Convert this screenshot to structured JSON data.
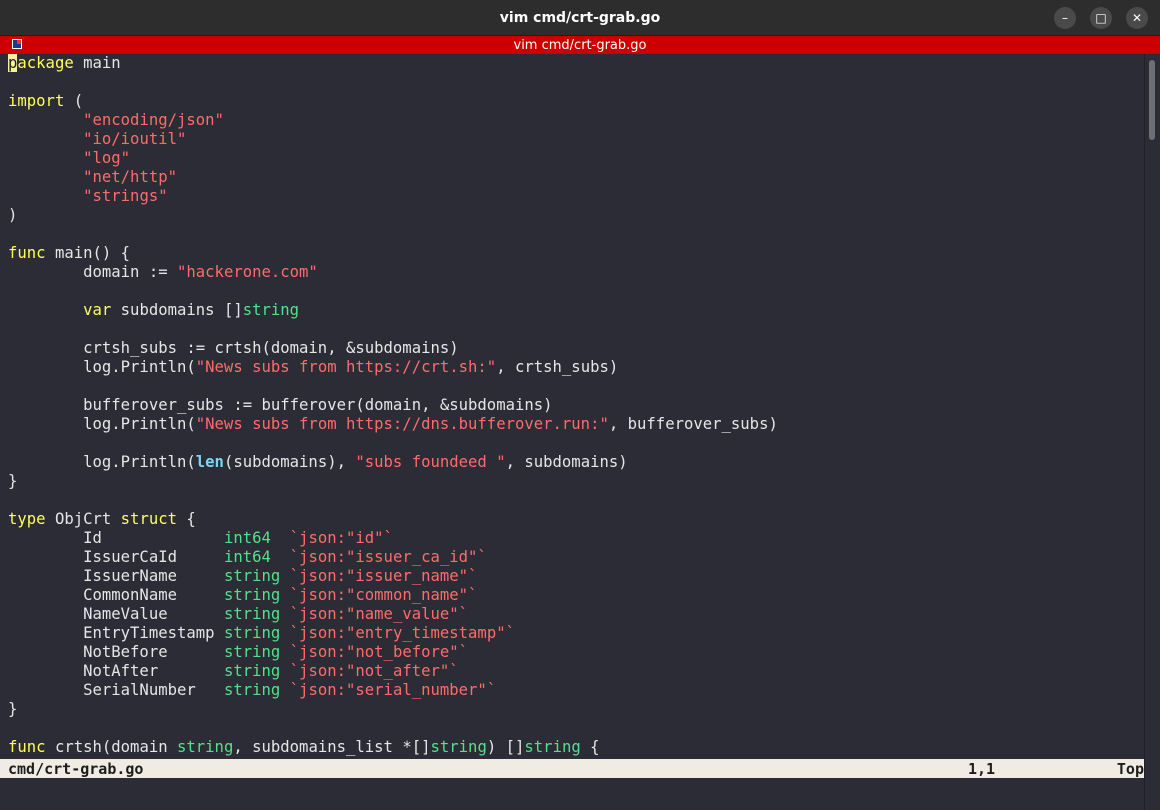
{
  "window": {
    "title": "vim cmd/crt-grab.go",
    "tab_title": "vim cmd/crt-grab.go",
    "minimize_icon": "minimize-icon",
    "maximize_icon": "maximize-icon",
    "close_icon": "close-icon"
  },
  "editor": {
    "lines": [
      [
        {
          "t": "p",
          "c": "cursor"
        },
        {
          "t": "ackage",
          "c": "kw"
        },
        {
          "t": " main",
          "c": ""
        }
      ],
      [],
      [
        {
          "t": "import",
          "c": "kw"
        },
        {
          "t": " (",
          "c": ""
        }
      ],
      [
        {
          "t": "        ",
          "c": ""
        },
        {
          "t": "\"encoding/json\"",
          "c": "str"
        }
      ],
      [
        {
          "t": "        ",
          "c": ""
        },
        {
          "t": "\"io/ioutil\"",
          "c": "str"
        }
      ],
      [
        {
          "t": "        ",
          "c": ""
        },
        {
          "t": "\"log\"",
          "c": "str"
        }
      ],
      [
        {
          "t": "        ",
          "c": ""
        },
        {
          "t": "\"net/http\"",
          "c": "str"
        }
      ],
      [
        {
          "t": "        ",
          "c": ""
        },
        {
          "t": "\"strings\"",
          "c": "str"
        }
      ],
      [
        {
          "t": ")",
          "c": ""
        }
      ],
      [],
      [
        {
          "t": "func",
          "c": "kw"
        },
        {
          "t": " main() {",
          "c": ""
        }
      ],
      [
        {
          "t": "        domain := ",
          "c": ""
        },
        {
          "t": "\"hackerone.com\"",
          "c": "str"
        }
      ],
      [],
      [
        {
          "t": "        ",
          "c": ""
        },
        {
          "t": "var",
          "c": "kw"
        },
        {
          "t": " subdomains []",
          "c": ""
        },
        {
          "t": "string",
          "c": "typ"
        }
      ],
      [],
      [
        {
          "t": "        crtsh_subs := crtsh(domain, &subdomains)",
          "c": ""
        }
      ],
      [
        {
          "t": "        log.Println(",
          "c": ""
        },
        {
          "t": "\"News subs from https://crt.sh:\"",
          "c": "str"
        },
        {
          "t": ", crtsh_subs)",
          "c": ""
        }
      ],
      [],
      [
        {
          "t": "        bufferover_subs := bufferover(domain, &subdomains)",
          "c": ""
        }
      ],
      [
        {
          "t": "        log.Println(",
          "c": ""
        },
        {
          "t": "\"News subs from https://dns.bufferover.run:\"",
          "c": "str"
        },
        {
          "t": ", bufferover_subs)",
          "c": ""
        }
      ],
      [],
      [
        {
          "t": "        log.Println(",
          "c": ""
        },
        {
          "t": "len",
          "c": "bi"
        },
        {
          "t": "(subdomains), ",
          "c": ""
        },
        {
          "t": "\"subs foundeed \"",
          "c": "str"
        },
        {
          "t": ", subdomains)",
          "c": ""
        }
      ],
      [
        {
          "t": "}",
          "c": ""
        }
      ],
      [],
      [
        {
          "t": "type",
          "c": "kw"
        },
        {
          "t": " ObjCrt ",
          "c": ""
        },
        {
          "t": "struct",
          "c": "kw"
        },
        {
          "t": " {",
          "c": ""
        }
      ],
      [
        {
          "t": "        Id             ",
          "c": ""
        },
        {
          "t": "int64",
          "c": "typ"
        },
        {
          "t": "  ",
          "c": ""
        },
        {
          "t": "`json:\"id\"`",
          "c": "str"
        }
      ],
      [
        {
          "t": "        IssuerCaId     ",
          "c": ""
        },
        {
          "t": "int64",
          "c": "typ"
        },
        {
          "t": "  ",
          "c": ""
        },
        {
          "t": "`json:\"issuer_ca_id\"`",
          "c": "str"
        }
      ],
      [
        {
          "t": "        IssuerName     ",
          "c": ""
        },
        {
          "t": "string",
          "c": "typ"
        },
        {
          "t": " ",
          "c": ""
        },
        {
          "t": "`json:\"issuer_name\"`",
          "c": "str"
        }
      ],
      [
        {
          "t": "        CommonName     ",
          "c": ""
        },
        {
          "t": "string",
          "c": "typ"
        },
        {
          "t": " ",
          "c": ""
        },
        {
          "t": "`json:\"common_name\"`",
          "c": "str"
        }
      ],
      [
        {
          "t": "        NameValue      ",
          "c": ""
        },
        {
          "t": "string",
          "c": "typ"
        },
        {
          "t": " ",
          "c": ""
        },
        {
          "t": "`json:\"name_value\"`",
          "c": "str"
        }
      ],
      [
        {
          "t": "        EntryTimestamp ",
          "c": ""
        },
        {
          "t": "string",
          "c": "typ"
        },
        {
          "t": " ",
          "c": ""
        },
        {
          "t": "`json:\"entry_timestamp\"`",
          "c": "str"
        }
      ],
      [
        {
          "t": "        NotBefore      ",
          "c": ""
        },
        {
          "t": "string",
          "c": "typ"
        },
        {
          "t": " ",
          "c": ""
        },
        {
          "t": "`json:\"not_before\"`",
          "c": "str"
        }
      ],
      [
        {
          "t": "        NotAfter       ",
          "c": ""
        },
        {
          "t": "string",
          "c": "typ"
        },
        {
          "t": " ",
          "c": ""
        },
        {
          "t": "`json:\"not_after\"`",
          "c": "str"
        }
      ],
      [
        {
          "t": "        SerialNumber   ",
          "c": ""
        },
        {
          "t": "string",
          "c": "typ"
        },
        {
          "t": " ",
          "c": ""
        },
        {
          "t": "`json:\"serial_number\"`",
          "c": "str"
        }
      ],
      [
        {
          "t": "}",
          "c": ""
        }
      ],
      [],
      [
        {
          "t": "func",
          "c": "kw"
        },
        {
          "t": " crtsh(domain ",
          "c": ""
        },
        {
          "t": "string",
          "c": "typ"
        },
        {
          "t": ", subdomains_list *[]",
          "c": ""
        },
        {
          "t": "string",
          "c": "typ"
        },
        {
          "t": ") []",
          "c": ""
        },
        {
          "t": "string",
          "c": "typ"
        },
        {
          "t": " {",
          "c": ""
        }
      ]
    ]
  },
  "statusline": {
    "filename": "cmd/crt-grab.go",
    "position": "1,1",
    "scroll": "Top"
  },
  "colors": {
    "tab_bar": "#cc0000",
    "editor_bg": "#2b2c35",
    "keyword": "#ffff55",
    "string": "#ff6b6b",
    "type": "#55e08a"
  }
}
